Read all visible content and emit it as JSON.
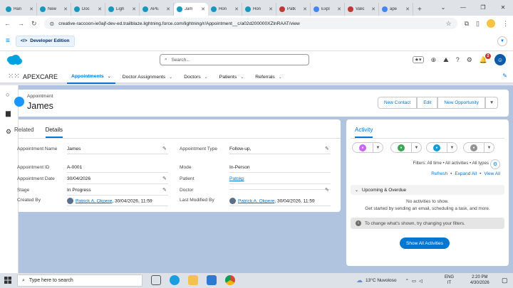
{
  "browser": {
    "tabs": [
      {
        "title": "Han",
        "color": "#1798c1"
      },
      {
        "title": "New",
        "color": "#1798c1"
      },
      {
        "title": "Doc",
        "color": "#1798c1"
      },
      {
        "title": "Ligh",
        "color": "#1798c1"
      },
      {
        "title": "APE",
        "color": "#1798c1"
      },
      {
        "title": "Jam",
        "color": "#1798c1"
      },
      {
        "title": "Hon",
        "color": "#1798c1"
      },
      {
        "title": "Hon",
        "color": "#1798c1"
      },
      {
        "title": "Patk",
        "color": "#c23934"
      },
      {
        "title": "Expl",
        "color": "#4285f4"
      },
      {
        "title": "Valic",
        "color": "#c23934"
      },
      {
        "title": "ape",
        "color": "#4285f4"
      }
    ],
    "new_tab": "+",
    "url": "creative-raccoon-ie0ajf-dev-ed.trailblaze.lightning.force.com/lightning/r/Appointment__c/a02d200000XZlnRAAT/view"
  },
  "bookmarks": {
    "dev_edition": "Developer Edition"
  },
  "sf_header": {
    "search_placeholder": "Search...",
    "notif_count": "2"
  },
  "app_nav": {
    "app_name": "APEXCARE",
    "items": [
      {
        "label": "Appointments",
        "active": true
      },
      {
        "label": "Doctor Assignments",
        "active": false
      },
      {
        "label": "Doctors",
        "active": false
      },
      {
        "label": "Patients",
        "active": false
      },
      {
        "label": "Referrals",
        "active": false
      }
    ]
  },
  "record": {
    "object_label": "Appointment",
    "name": "James",
    "actions": [
      "New Contact",
      "Edit",
      "New Opportunity"
    ]
  },
  "details": {
    "tabs": [
      "Related",
      "Details"
    ],
    "left_fields": [
      {
        "label": "Appointment Name",
        "value": "James"
      },
      {
        "label": "Appointment ID",
        "value": "A-0001"
      },
      {
        "label": "Appointment Date",
        "value": "30/04/2026"
      },
      {
        "label": "Stage",
        "value": "In Progress"
      },
      {
        "label": "Created By",
        "value": "Patrick A. Okpere",
        "suffix": ", 30/04/2026, 11:59"
      }
    ],
    "right_fields": [
      {
        "label": "Appointment Type",
        "value": "Follow-up,"
      },
      {
        "label": "Mode",
        "value": "In-Person"
      },
      {
        "label": "Patient",
        "value": "Patokp"
      },
      {
        "label": "Doctor",
        "value": ""
      },
      {
        "label": "Last Modified By",
        "value": "Patrick A. Okpere",
        "suffix": ", 30/04/2026, 11:59"
      }
    ]
  },
  "activity": {
    "tab": "Activity",
    "filters": "Filters: All time • All activities • All types",
    "links": [
      "Refresh",
      "Expand All",
      "View All"
    ],
    "upcoming": "Upcoming & Overdue",
    "no_activities": "No activities to show.",
    "get_started": "Get started by sending an email, scheduling a task, and more.",
    "info": "To change what's shown, try changing your filters.",
    "show_all": "Show All Activities",
    "buttons": [
      {
        "icon": "event-icon",
        "color": "#cb65ff"
      },
      {
        "icon": "task-icon",
        "color": "#3ba755"
      },
      {
        "icon": "call-icon",
        "color": "#0d9dda"
      },
      {
        "icon": "email-icon",
        "color": "#939393"
      }
    ]
  },
  "taskbar": {
    "search_placeholder": "Type here to search",
    "weather": "13°C Nuvoloso",
    "lang": "ENG",
    "region": "IT",
    "time": "2:20 PM",
    "date": "4/30/2026"
  }
}
